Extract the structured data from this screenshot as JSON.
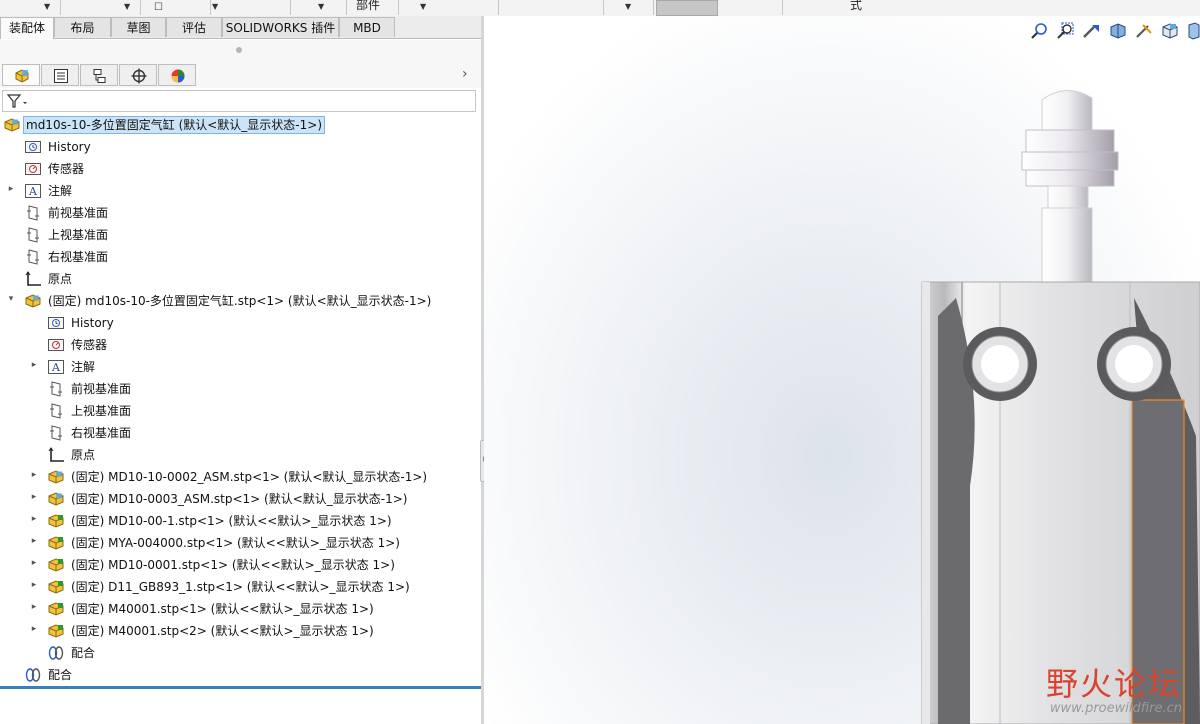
{
  "toolbar": {
    "part_label": "部件",
    "style_label": "式"
  },
  "tabs": [
    {
      "label": "装配体"
    },
    {
      "label": "布局"
    },
    {
      "label": "草图"
    },
    {
      "label": "评估"
    },
    {
      "label": "SOLIDWORKS 插件"
    },
    {
      "label": "MBD"
    }
  ],
  "panel_tabs": [
    {
      "icon": "featuremanager-tree-icon"
    },
    {
      "icon": "property-manager-icon"
    },
    {
      "icon": "configuration-manager-icon"
    },
    {
      "icon": "dimxpert-manager-icon"
    },
    {
      "icon": "display-manager-icon"
    }
  ],
  "filter": {
    "icon": "filter-icon"
  },
  "tree": {
    "root": "md10s-10-多位置固定气缸  (默认<默认_显示状态-1>)",
    "items": [
      {
        "label": "History",
        "icon": "history-icon",
        "level": 1
      },
      {
        "label": "传感器",
        "icon": "sensors-icon",
        "level": 1
      },
      {
        "label": "注解",
        "icon": "annotations-icon",
        "level": 1,
        "expand": "collapsed"
      },
      {
        "label": "前视基准面",
        "icon": "plane-icon",
        "level": 1
      },
      {
        "label": "上视基准面",
        "icon": "plane-icon",
        "level": 1
      },
      {
        "label": "右视基准面",
        "icon": "plane-icon",
        "level": 1
      },
      {
        "label": "原点",
        "icon": "origin-icon",
        "level": 1
      },
      {
        "label": "(固定) md10s-10-多位置固定气缸.stp<1> (默认<默认_显示状态-1>)",
        "icon": "subassembly-icon",
        "level": 1,
        "expand": "expanded"
      },
      {
        "label": "History",
        "icon": "history-icon",
        "level": 2
      },
      {
        "label": "传感器",
        "icon": "sensors-icon",
        "level": 2
      },
      {
        "label": "注解",
        "icon": "annotations-icon",
        "level": 2,
        "expand": "collapsed"
      },
      {
        "label": "前视基准面",
        "icon": "plane-icon",
        "level": 2
      },
      {
        "label": "上视基准面",
        "icon": "plane-icon",
        "level": 2
      },
      {
        "label": "右视基准面",
        "icon": "plane-icon",
        "level": 2
      },
      {
        "label": "原点",
        "icon": "origin-icon",
        "level": 2
      },
      {
        "label": "(固定) MD10-10-0002_ASM.stp<1> (默认<默认_显示状态-1>)",
        "icon": "subassembly-icon",
        "level": 2,
        "expand": "collapsed"
      },
      {
        "label": "(固定) MD10-0003_ASM.stp<1> (默认<默认_显示状态-1>)",
        "icon": "subassembly-icon",
        "level": 2,
        "expand": "collapsed"
      },
      {
        "label": "(固定) MD10-00-1.stp<1> (默认<<默认>_显示状态 1>)",
        "icon": "part-icon",
        "level": 2,
        "expand": "collapsed"
      },
      {
        "label": "(固定) MYA-004000.stp<1> (默认<<默认>_显示状态 1>)",
        "icon": "part-icon",
        "level": 2,
        "expand": "collapsed"
      },
      {
        "label": "(固定) MD10-0001.stp<1> (默认<<默认>_显示状态 1>)",
        "icon": "part-icon",
        "level": 2,
        "expand": "collapsed"
      },
      {
        "label": "(固定) D11_GB893_1.stp<1> (默认<<默认>_显示状态 1>)",
        "icon": "part-icon",
        "level": 2,
        "expand": "collapsed"
      },
      {
        "label": "(固定) M40001.stp<1> (默认<<默认>_显示状态 1>)",
        "icon": "part-icon",
        "level": 2,
        "expand": "collapsed"
      },
      {
        "label": "(固定) M40001.stp<2> (默认<<默认>_显示状态 1>)",
        "icon": "part-icon",
        "level": 2,
        "expand": "collapsed"
      },
      {
        "label": "配合",
        "icon": "mates-icon",
        "level": 2
      },
      {
        "label": "配合",
        "icon": "mates-icon",
        "level": 1
      }
    ]
  },
  "view_tools": [
    {
      "icon": "zoom-to-fit-icon"
    },
    {
      "icon": "zoom-to-area-icon"
    },
    {
      "icon": "previous-view-icon"
    },
    {
      "icon": "section-view-icon"
    },
    {
      "icon": "dynamic-annotation-icon"
    },
    {
      "icon": "view-orientation-icon"
    },
    {
      "icon": "display-style-icon"
    }
  ],
  "watermark": {
    "title": "野火论坛",
    "url": "www.proewildfire.cn"
  }
}
